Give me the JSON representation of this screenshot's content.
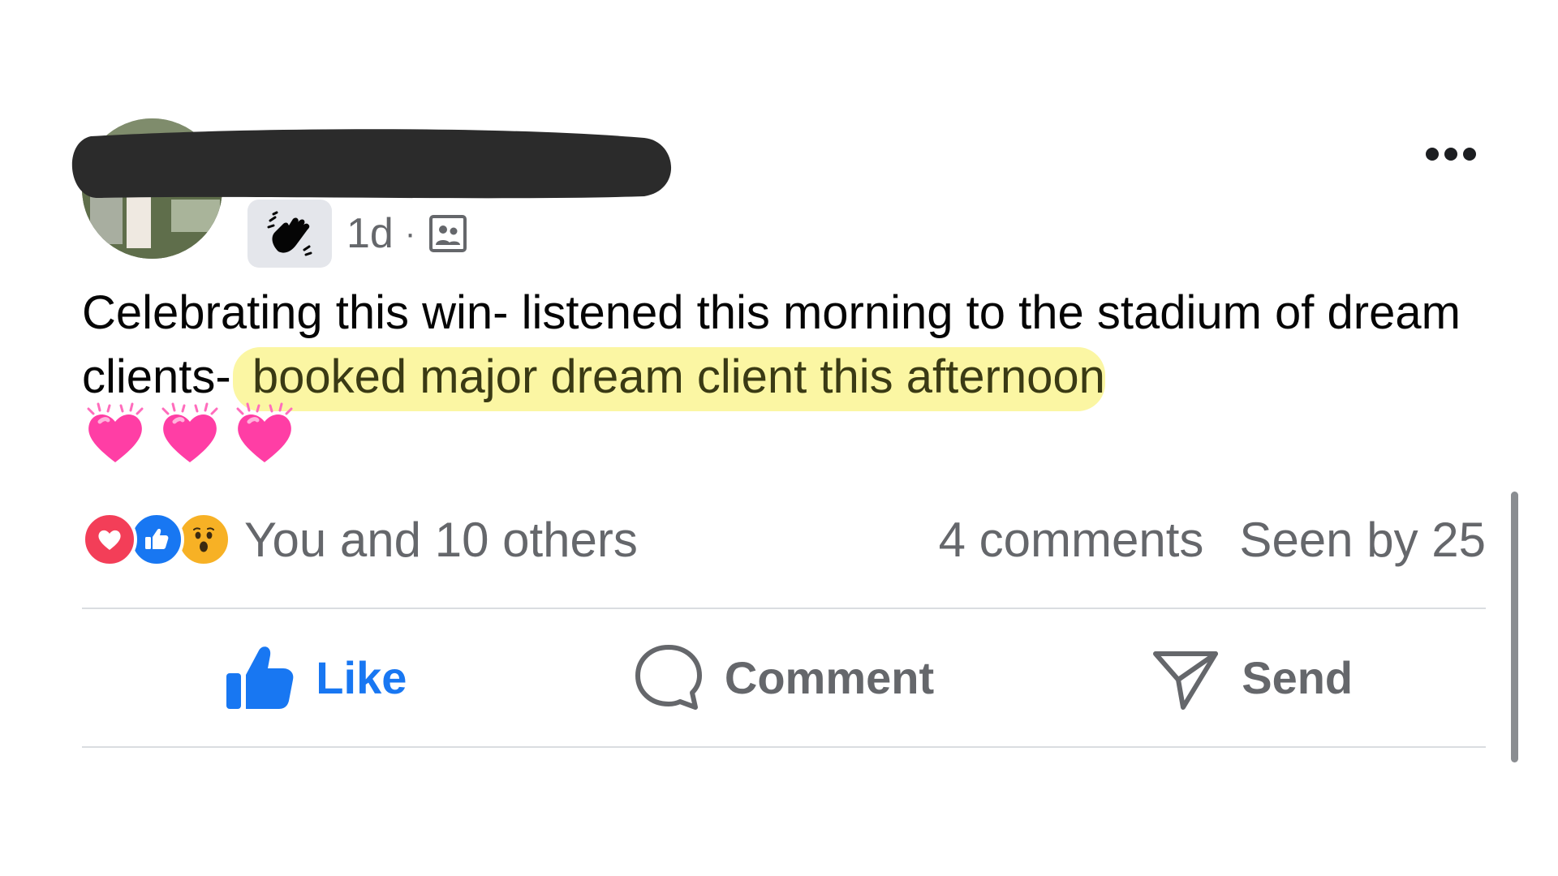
{
  "post": {
    "time": "1d",
    "separator": "·",
    "text_before_highlight": "Celebrating this win- listened this morning to the stadium of dream clients- ",
    "text_highlight": "booked major dream client this afternoon",
    "emoji_count": 3
  },
  "reactions": {
    "types": [
      "love",
      "like",
      "wow"
    ],
    "summary": "You and 10 others"
  },
  "stats": {
    "comments": "4 comments",
    "seen_by": "Seen by 25"
  },
  "actions": {
    "like": "Like",
    "comment": "Comment",
    "send": "Send"
  },
  "icons": {
    "more": "more-options-icon",
    "wave": "wave-hand-icon",
    "audience": "audience-friends-icon",
    "heart": "growing-heart-emoji",
    "like": "thumbs-up-icon",
    "comment": "speech-bubble-icon",
    "send": "paper-plane-icon"
  },
  "colors": {
    "accent": "#1877f2",
    "secondary_text": "#65676b",
    "highlight": "#fbf6a3",
    "love": "#f33e58",
    "wow": "#f7b125",
    "heart": "#ff3ea5"
  }
}
